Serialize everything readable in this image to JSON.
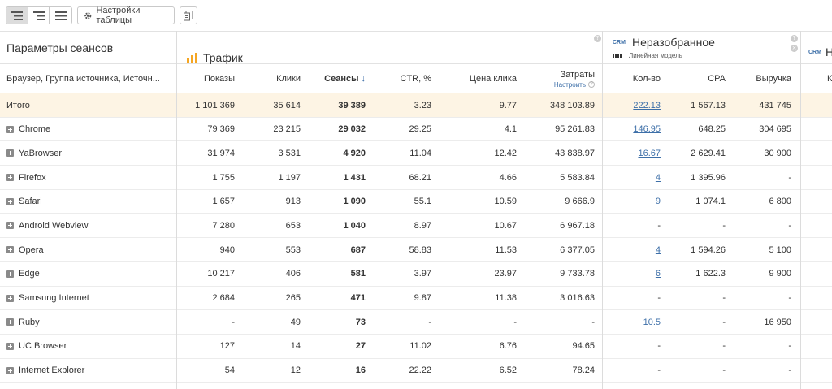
{
  "toolbar": {
    "settings_label": "Настройки таблицы"
  },
  "groups": {
    "params_title": "Параметры сеансов",
    "traffic_title": "Трафик",
    "unsorted_badge": "CRM",
    "unsorted_title": "Неразобранное",
    "unsorted_model": "Линейная модель",
    "next_badge": "CRM",
    "next_title": "Н"
  },
  "columns": {
    "dims": "Браузер, Группа источника, Источн...",
    "shows": "Показы",
    "clicks": "Клики",
    "sessions": "Сеансы",
    "sort_arrow": "↓",
    "ctr": "CTR, %",
    "cpc": "Цена клика",
    "cost": "Затраты",
    "cost_link": "Настроить",
    "qty": "Кол-во",
    "cpa": "CPA",
    "revenue": "Выручка",
    "next": "К"
  },
  "rows": [
    {
      "name": "Итого",
      "shows": "1 101 369",
      "clicks": "35 614",
      "sessions": "39 389",
      "ctr": "3.23",
      "cpc": "9.77",
      "cost": "348 103.89",
      "qty": "222.13",
      "cpa": "1 567.13",
      "revenue": "431 745"
    },
    {
      "name": "Chrome",
      "shows": "79 369",
      "clicks": "23 215",
      "sessions": "29 032",
      "ctr": "29.25",
      "cpc": "4.1",
      "cost": "95 261.83",
      "qty": "146.95",
      "cpa": "648.25",
      "revenue": "304 695"
    },
    {
      "name": "YaBrowser",
      "shows": "31 974",
      "clicks": "3 531",
      "sessions": "4 920",
      "ctr": "11.04",
      "cpc": "12.42",
      "cost": "43 838.97",
      "qty": "16.67",
      "cpa": "2 629.41",
      "revenue": "30 900"
    },
    {
      "name": "Firefox",
      "shows": "1 755",
      "clicks": "1 197",
      "sessions": "1 431",
      "ctr": "68.21",
      "cpc": "4.66",
      "cost": "5 583.84",
      "qty": "4",
      "cpa": "1 395.96",
      "revenue": "-"
    },
    {
      "name": "Safari",
      "shows": "1 657",
      "clicks": "913",
      "sessions": "1 090",
      "ctr": "55.1",
      "cpc": "10.59",
      "cost": "9 666.9",
      "qty": "9",
      "cpa": "1 074.1",
      "revenue": "6 800"
    },
    {
      "name": "Android Webview",
      "shows": "7 280",
      "clicks": "653",
      "sessions": "1 040",
      "ctr": "8.97",
      "cpc": "10.67",
      "cost": "6 967.18",
      "qty": "-",
      "cpa": "-",
      "revenue": "-"
    },
    {
      "name": "Opera",
      "shows": "940",
      "clicks": "553",
      "sessions": "687",
      "ctr": "58.83",
      "cpc": "11.53",
      "cost": "6 377.05",
      "qty": "4",
      "cpa": "1 594.26",
      "revenue": "5 100"
    },
    {
      "name": "Edge",
      "shows": "10 217",
      "clicks": "406",
      "sessions": "581",
      "ctr": "3.97",
      "cpc": "23.97",
      "cost": "9 733.78",
      "qty": "6",
      "cpa": "1 622.3",
      "revenue": "9 900"
    },
    {
      "name": "Samsung Internet",
      "shows": "2 684",
      "clicks": "265",
      "sessions": "471",
      "ctr": "9.87",
      "cpc": "11.38",
      "cost": "3 016.63",
      "qty": "-",
      "cpa": "-",
      "revenue": "-"
    },
    {
      "name": "Ruby",
      "shows": "-",
      "clicks": "49",
      "sessions": "73",
      "ctr": "-",
      "cpc": "-",
      "cost": "-",
      "qty": "10.5",
      "cpa": "-",
      "revenue": "16 950"
    },
    {
      "name": "UC Browser",
      "shows": "127",
      "clicks": "14",
      "sessions": "27",
      "ctr": "11.02",
      "cpc": "6.76",
      "cost": "94.65",
      "qty": "-",
      "cpa": "-",
      "revenue": "-"
    },
    {
      "name": "Internet Explorer",
      "shows": "54",
      "clicks": "12",
      "sessions": "16",
      "ctr": "22.22",
      "cpc": "6.52",
      "cost": "78.24",
      "qty": "-",
      "cpa": "-",
      "revenue": "-"
    }
  ]
}
